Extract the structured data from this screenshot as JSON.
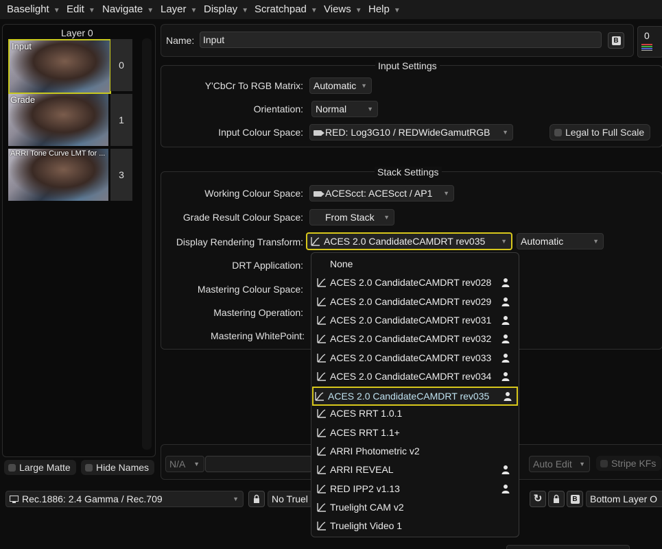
{
  "menubar": {
    "items": [
      "Baselight",
      "Edit",
      "Navigate",
      "Layer",
      "Display",
      "Scratchpad",
      "Views",
      "Help"
    ]
  },
  "layers": {
    "title": "Layer 0",
    "items": [
      {
        "label": "Input",
        "num": "0"
      },
      {
        "label": "Grade",
        "num": "1"
      },
      {
        "label": "ARRI Tone Curve LMT for ...",
        "num": "3"
      }
    ],
    "large_matte": "Large Matte",
    "hide_names": "Hide Names"
  },
  "name": {
    "label": "Name:",
    "value": "Input",
    "b_glyph": "B",
    "counter": "0"
  },
  "input_settings": {
    "title": "Input Settings",
    "matrix_label": "Y'CbCr To RGB Matrix:",
    "matrix_value": "Automatic",
    "orientation_label": "Orientation:",
    "orientation_value": "Normal",
    "colour_space_label": "Input Colour Space:",
    "colour_space_value": "RED: Log3G10 / REDWideGamutRGB",
    "legal_label": "Legal to Full Scale"
  },
  "stack_settings": {
    "title": "Stack Settings",
    "working_label": "Working Colour Space:",
    "working_value": "ACEScct: ACEScct / AP1",
    "grade_result_label": "Grade Result Colour Space:",
    "grade_result_value": "From Stack",
    "drt_label": "Display Rendering Transform:",
    "drt_value": "ACES 2.0 CandidateCAMDRT rev035",
    "drt_mode": "Automatic",
    "drt_app_label": "DRT Application:",
    "mastering_cs_label": "Mastering Colour Space:",
    "mastering_op_label": "Mastering Operation:",
    "mastering_wp_label": "Mastering WhitePoint:"
  },
  "drt_options": [
    {
      "label": "None",
      "icon": "none",
      "user": false
    },
    {
      "label": "ACES 2.0 CandidateCAMDRT rev028",
      "icon": "curve",
      "user": true
    },
    {
      "label": "ACES 2.0 CandidateCAMDRT rev029",
      "icon": "curve",
      "user": true
    },
    {
      "label": "ACES 2.0 CandidateCAMDRT rev031",
      "icon": "curve",
      "user": true
    },
    {
      "label": "ACES 2.0 CandidateCAMDRT rev032",
      "icon": "curve",
      "user": true
    },
    {
      "label": "ACES 2.0 CandidateCAMDRT rev033",
      "icon": "curve",
      "user": true
    },
    {
      "label": "ACES 2.0 CandidateCAMDRT rev034",
      "icon": "curve",
      "user": true
    },
    {
      "label": "ACES 2.0 CandidateCAMDRT rev035",
      "icon": "curve",
      "user": true,
      "selected": true
    },
    {
      "label": "ACES RRT 1.0.1",
      "icon": "curve",
      "user": false
    },
    {
      "label": "ACES RRT 1.1+",
      "icon": "curve",
      "user": false
    },
    {
      "label": "ARRI Photometric v2",
      "icon": "curve",
      "user": false
    },
    {
      "label": "ARRI REVEAL",
      "icon": "curve",
      "user": true
    },
    {
      "label": "RED IPP2 v1.13",
      "icon": "curve",
      "user": true
    },
    {
      "label": "Truelight CAM v2",
      "icon": "curve",
      "user": false
    },
    {
      "label": "Truelight Video 1",
      "icon": "curve",
      "user": false
    }
  ],
  "bottom_bar": {
    "na": "N/A",
    "auto_edit": "Auto Edit",
    "stripe_kfs": "Stripe KFs"
  },
  "status": {
    "display_transform": "Rec.1886: 2.4 Gamma / Rec.709",
    "truelight": "No Truel",
    "bottom_layer": "Bottom Layer O",
    "b_glyph": "B"
  }
}
